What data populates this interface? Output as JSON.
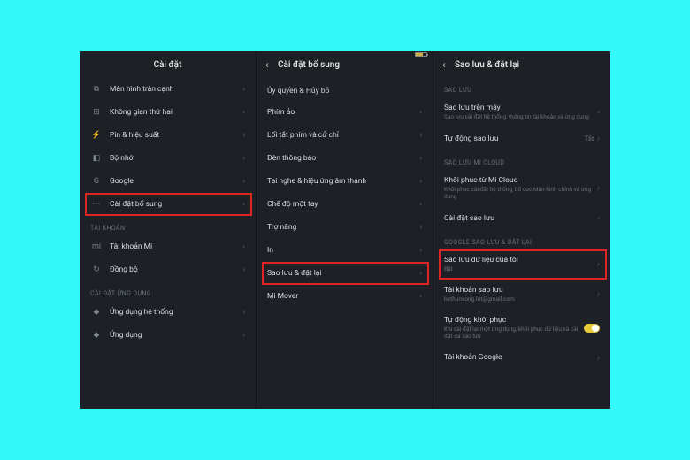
{
  "panel1": {
    "title": "Cài đặt",
    "items_top": [
      {
        "icon": "⧉",
        "label": "Màn hình tràn cạnh"
      },
      {
        "icon": "⊞",
        "label": "Không gian thứ hai"
      },
      {
        "icon": "⚡",
        "label": "Pin & hiệu suất"
      },
      {
        "icon": "◧",
        "label": "Bộ nhớ"
      },
      {
        "icon": "G",
        "label": "Google"
      },
      {
        "icon": "⋯",
        "label": "Cài đặt bổ sung",
        "hl": true
      }
    ],
    "section_account": "TÀI KHOẢN",
    "items_account": [
      {
        "icon": "mi",
        "label": "Tài khoản Mi"
      },
      {
        "icon": "↻",
        "label": "Đồng bộ"
      }
    ],
    "section_app": "CÀI ĐẶT ỨNG DỤNG",
    "items_app": [
      {
        "icon": "◆",
        "label": "Ứng dụng hệ thống"
      },
      {
        "icon": "◆",
        "label": "Ứng dụng"
      }
    ]
  },
  "panel2": {
    "title": "Cài đặt bổ sung",
    "subhead": "Ủy quyền & Hủy bỏ",
    "items": [
      {
        "label": "Phím ảo"
      },
      {
        "label": "Lối tắt phím và cử chỉ"
      },
      {
        "label": "Đèn thông báo"
      },
      {
        "label": "Tai nghe & hiệu ứng âm thanh"
      },
      {
        "label": "Chế độ một tay"
      },
      {
        "label": "Trợ năng"
      },
      {
        "label": "In"
      },
      {
        "label": "Sao lưu & đặt lại",
        "hl": true
      },
      {
        "label": "Mi Mover"
      }
    ]
  },
  "panel3": {
    "title": "Sao lưu & đặt lại",
    "section_backup": "SAO LƯU",
    "items_backup": [
      {
        "label": "Sao lưu trên máy",
        "sub": "Sao lưu cài đặt hệ thống, thông tin tài khoản và ứng dụng"
      },
      {
        "label": "Tự động sao lưu",
        "val": "Tắt"
      }
    ],
    "section_micloud": "SAO LƯU MI CLOUD",
    "items_micloud": [
      {
        "label": "Khôi phục từ Mi Cloud",
        "sub": "Khôi phục cài đặt hệ thống, bố cục Màn hình chính và ứng dụng"
      },
      {
        "label": "Cài đặt sao lưu"
      }
    ],
    "section_google": "GOOGLE SAO LƯU & ĐẶT LẠI",
    "items_google": [
      {
        "label": "Sao lưu dữ liệu của tôi",
        "sub": "Bật",
        "hl": true
      },
      {
        "label": "Tài khoản sao lưu",
        "sub": "bethunsong.lot@gmail.com"
      },
      {
        "label": "Tự động khôi phục",
        "sub": "Khi cài đặt lại một ứng dụng, khôi phục dữ liệu và cài đặt đã sao lưu",
        "toggle": true
      },
      {
        "label": "Tài khoản Google"
      }
    ]
  }
}
